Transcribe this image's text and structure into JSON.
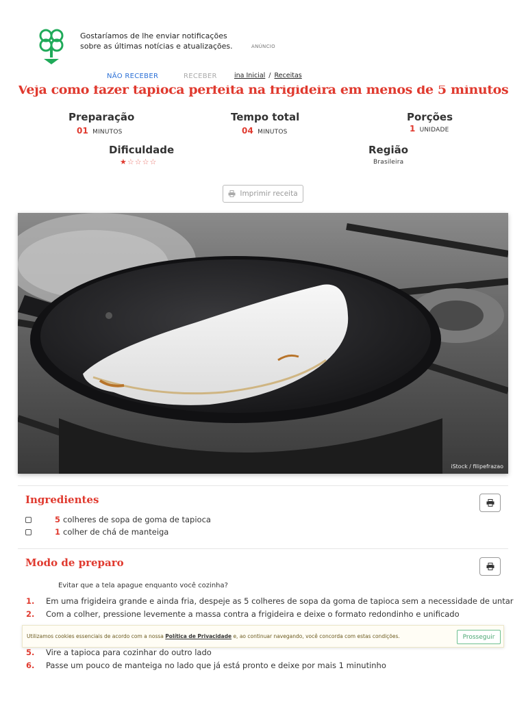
{
  "notification": {
    "message": "Gostaríamos de lhe enviar notificações sobre as últimas notícias e atualizações.",
    "ad_label": "ANÚNCIO",
    "decline_label": "NÃO RECEBER",
    "accept_label": "RECEBER"
  },
  "breadcrumb": {
    "home": "ina Inicial",
    "separator": "/",
    "current": "Receitas"
  },
  "recipe": {
    "title": "Veja como fazer tapioca perfeita na frigideira em menos de 5 minutos",
    "prep": {
      "label": "Preparação",
      "value": "01",
      "unit": "MINUTOS"
    },
    "total": {
      "label": "Tempo total",
      "value": "04",
      "unit": "MINUTOS"
    },
    "servings": {
      "label": "Porções",
      "value": "1",
      "unit": "UNIDADE"
    },
    "difficulty": {
      "label": "Dificuldade",
      "stars_filled": 1,
      "stars_total": 5
    },
    "region": {
      "label": "Região",
      "value": "Brasileira"
    },
    "print_label": "Imprimir receita",
    "photo_credit": "iStock / filipefrazao"
  },
  "ingredients": {
    "title": "Ingredientes",
    "items": [
      {
        "qty": "5",
        "text": "colheres de sopa de goma de tapioca"
      },
      {
        "qty": "1",
        "text": "colher de chá de manteiga"
      }
    ]
  },
  "method": {
    "title": "Modo de preparo",
    "keep_screen": "Evitar que a tela apague enquanto você cozinha?",
    "steps": [
      {
        "n": "1.",
        "text": "Em uma frigideira grande e ainda fria, despeje as 5 colheres de sopa da goma de tapioca sem a necessidade de untar"
      },
      {
        "n": "2.",
        "text": "Com a colher, pressione levemente a massa contra a frigideira e deixe o formato redondinho e unificado"
      },
      {
        "n": "5.",
        "text": "Vire a tapioca para cozinhar do outro lado"
      },
      {
        "n": "6.",
        "text": "Passe um pouco de manteiga no lado que já está pronto e deixe por mais 1 minutinho"
      }
    ]
  },
  "cookie": {
    "text_before": "Utilizamos cookies essenciais de acordo com a nossa",
    "link": "Política de Privacidade",
    "text_after": "e, ao continuar navegando, você concorda com estas condições.",
    "button": "Prosseguir"
  },
  "colors": {
    "accent": "#e03a2f",
    "logo_green": "#1faa59",
    "link_blue": "#2a6fd6"
  }
}
